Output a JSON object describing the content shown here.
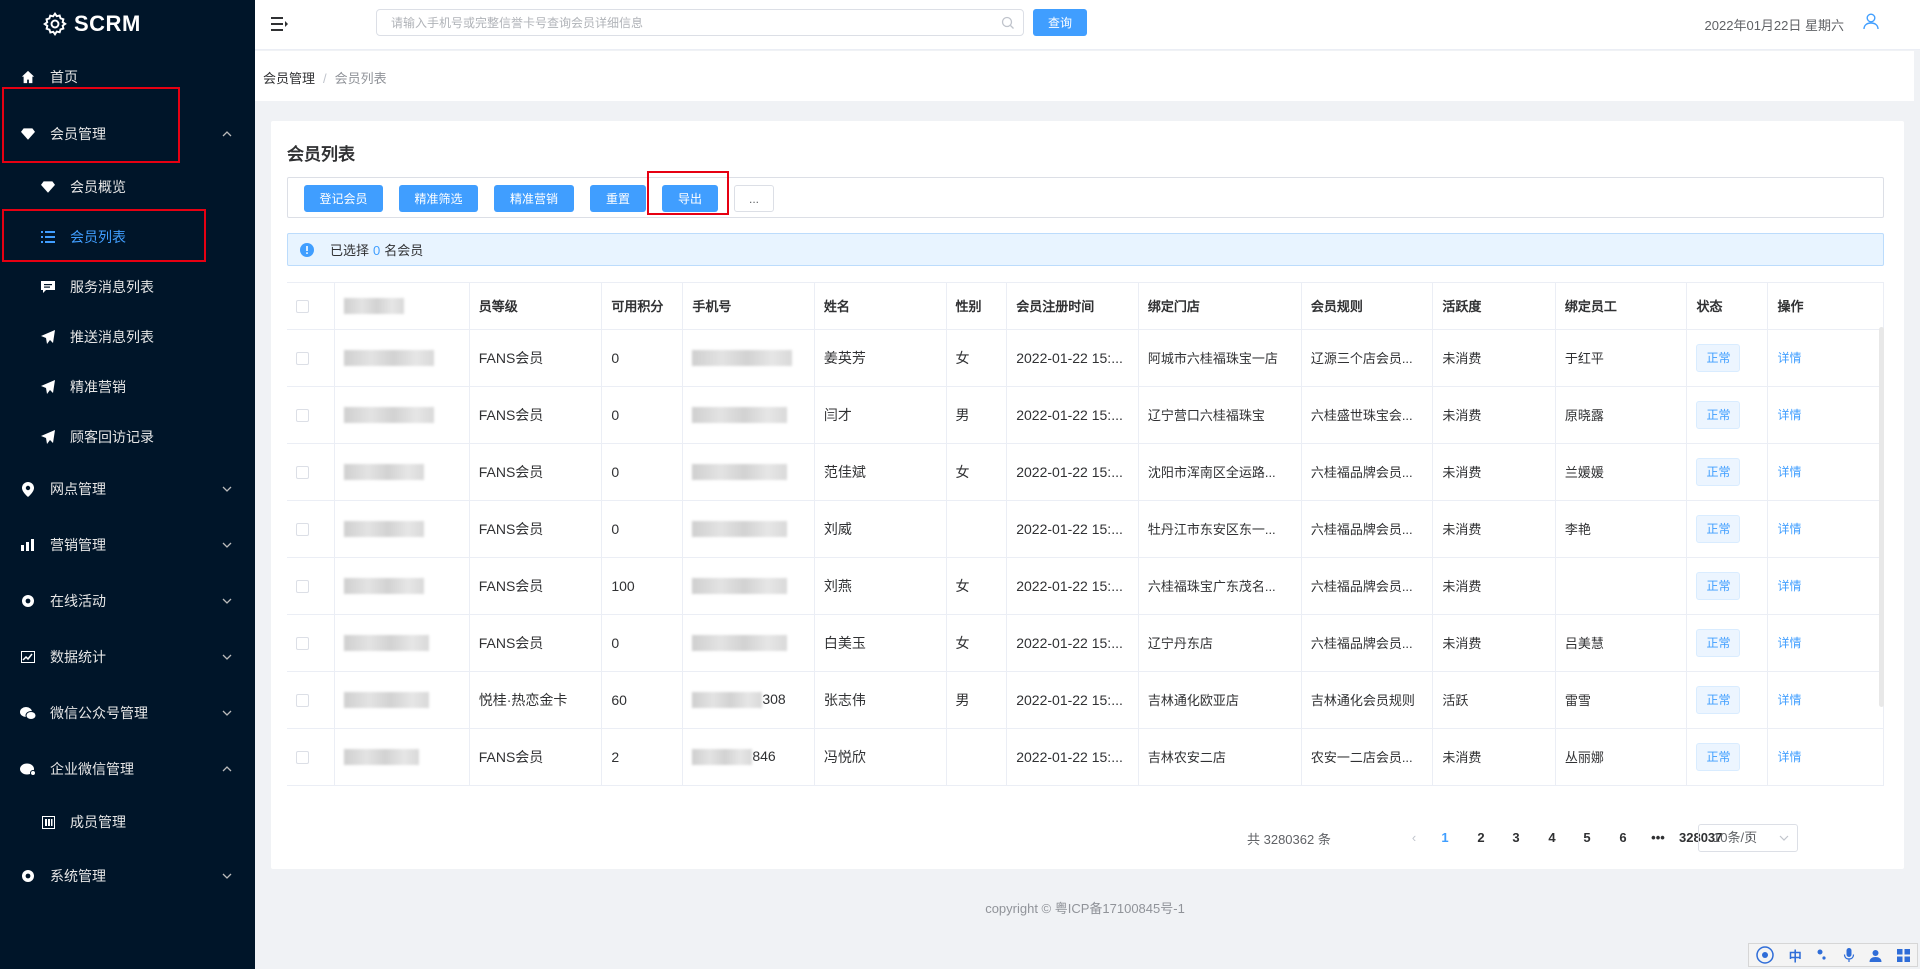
{
  "app": {
    "name": "SCRM"
  },
  "sidebar": {
    "items": [
      {
        "label": "首页"
      },
      {
        "label": "会员管理"
      },
      {
        "label": "会员概览"
      },
      {
        "label": "会员列表"
      },
      {
        "label": "服务消息列表"
      },
      {
        "label": "推送消息列表"
      },
      {
        "label": "精准营销"
      },
      {
        "label": "顾客回访记录"
      },
      {
        "label": "网点管理"
      },
      {
        "label": "营销管理"
      },
      {
        "label": "在线活动"
      },
      {
        "label": "数据统计"
      },
      {
        "label": "微信公众号管理"
      },
      {
        "label": "企业微信管理"
      },
      {
        "label": "成员管理"
      },
      {
        "label": "系统管理"
      }
    ]
  },
  "header": {
    "search_placeholder": "请输入手机号或完整信誉卡号查询会员详细信息",
    "query_button": "查询",
    "date": "2022年01月22日 星期六"
  },
  "breadcrumb": {
    "level1": "会员管理",
    "separator": "/",
    "level2": "会员列表"
  },
  "card": {
    "title": "会员列表",
    "toolbar": {
      "register": "登记会员",
      "filter": "精准筛选",
      "marketing": "精准营销",
      "reset": "重置",
      "export": "导出",
      "more": "..."
    },
    "selection": {
      "prefix": "已选择",
      "count": "0",
      "suffix": "名会员"
    }
  },
  "table": {
    "columns": [
      "",
      "",
      "员等级",
      "可用积分",
      "手机号",
      "姓名",
      "性别",
      "会员注册时间",
      "绑定门店",
      "会员规则",
      "活跃度",
      "绑定员工",
      "状态",
      "操作"
    ],
    "rows": [
      {
        "level": "FANS会员",
        "points": "0",
        "phone_suffix": "",
        "name": "姜英芳",
        "gender": "女",
        "reg_time": "2022-01-22 15:...",
        "store": "阿城市六桂福珠宝一店",
        "rule": "辽源三个店会员...",
        "activity": "未消费",
        "staff": "于红平",
        "status": "正常",
        "action": "详情"
      },
      {
        "level": "FANS会员",
        "points": "0",
        "phone_suffix": "",
        "name": "闫才",
        "gender": "男",
        "reg_time": "2022-01-22 15:...",
        "store": "辽宁营口六桂福珠宝",
        "rule": "六桂盛世珠宝会...",
        "activity": "未消费",
        "staff": "原晓露",
        "status": "正常",
        "action": "详情"
      },
      {
        "level": "FANS会员",
        "points": "0",
        "phone_suffix": "",
        "name": "范佳斌",
        "gender": "女",
        "reg_time": "2022-01-22 15:...",
        "store": "沈阳市浑南区全运路...",
        "rule": "六桂福品牌会员...",
        "activity": "未消费",
        "staff": "兰媛媛",
        "status": "正常",
        "action": "详情"
      },
      {
        "level": "FANS会员",
        "points": "0",
        "phone_suffix": "",
        "name": "刘威",
        "gender": "",
        "reg_time": "2022-01-22 15:...",
        "store": "牡丹江市东安区东一...",
        "rule": "六桂福品牌会员...",
        "activity": "未消费",
        "staff": "李艳",
        "status": "正常",
        "action": "详情"
      },
      {
        "level": "FANS会员",
        "points": "100",
        "phone_suffix": "",
        "name": "刘燕",
        "gender": "女",
        "reg_time": "2022-01-22 15:...",
        "store": "六桂福珠宝广东茂名...",
        "rule": "六桂福品牌会员...",
        "activity": "未消费",
        "staff": "",
        "status": "正常",
        "action": "详情"
      },
      {
        "level": "FANS会员",
        "points": "0",
        "phone_suffix": "",
        "name": "白美玉",
        "gender": "女",
        "reg_time": "2022-01-22 15:...",
        "store": "辽宁丹东店",
        "rule": "六桂福品牌会员...",
        "activity": "未消费",
        "staff": "吕美慧",
        "status": "正常",
        "action": "详情"
      },
      {
        "level": "悦桂·热恋金卡",
        "points": "60",
        "phone_suffix": "308",
        "name": "张志伟",
        "gender": "男",
        "reg_time": "2022-01-22 15:...",
        "store": "吉林通化欧亚店",
        "rule": "吉林通化会员规则",
        "activity": "活跃",
        "staff": "雷雪",
        "status": "正常",
        "action": "详情"
      },
      {
        "level": "FANS会员",
        "points": "2",
        "phone_suffix": "846",
        "name": "冯悦欣",
        "gender": "",
        "reg_time": "2022-01-22 15:...",
        "store": "吉林农安二店",
        "rule": "农安一二店会员...",
        "activity": "未消费",
        "staff": "丛丽娜",
        "status": "正常",
        "action": "详情"
      }
    ]
  },
  "pagination": {
    "total": "共 3280362 条",
    "pages": [
      "1",
      "2",
      "3",
      "4",
      "5",
      "6",
      "•••",
      "328037"
    ],
    "current": "1",
    "page_size": "10条/页"
  },
  "footer": {
    "copyright": "copyright © 粤ICP备17100845号-1"
  },
  "ime": {
    "mode": "中"
  },
  "colors": {
    "sidebar_bg": "#001529",
    "primary": "#409eff",
    "highlight_box": "#e60012"
  }
}
